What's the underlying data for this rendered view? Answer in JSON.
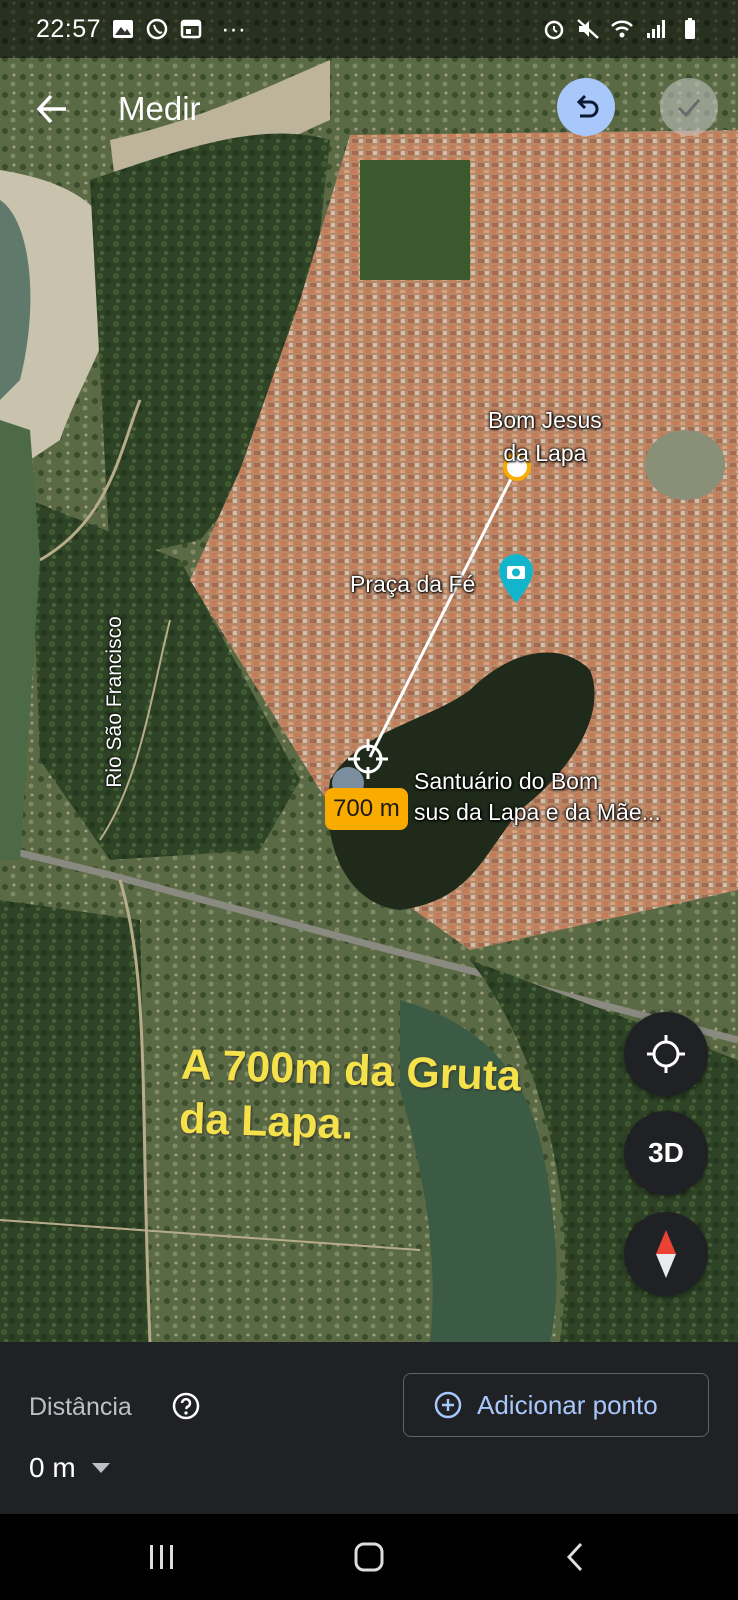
{
  "status_bar": {
    "time": "22:57",
    "more": "···",
    "left_icons": [
      "image-icon",
      "whatsapp-icon",
      "calendar-icon"
    ],
    "right_icons": [
      "alarm-icon",
      "mute-icon",
      "wifi-icon",
      "signal-icon",
      "battery-icon"
    ]
  },
  "toolbar": {
    "title": "Medir",
    "undo_icon": "undo-icon",
    "done_icon": "check-icon"
  },
  "map": {
    "labels": {
      "city": "Bom Jesus\nda Lapa",
      "praca": "Praça da Fé",
      "santuario": "Santuário do Bom\nsus da Lapa e da Mãe...",
      "river": "Rio São Francisco"
    },
    "distance_chip": "700 m",
    "annotation": "A 700m da Gruta\nda Lapa."
  },
  "fabs": {
    "location_icon": "my-location-icon",
    "three_d": "3D",
    "compass_icon": "compass-icon"
  },
  "panel": {
    "distance_label": "Distância",
    "distance_value": "0 m",
    "add_point": "Adicionar ponto"
  },
  "colors": {
    "accent": "#a8c7fa",
    "chip": "#f9ab00",
    "annotation": "#f5e14a",
    "panel_bg": "#1f2124"
  }
}
